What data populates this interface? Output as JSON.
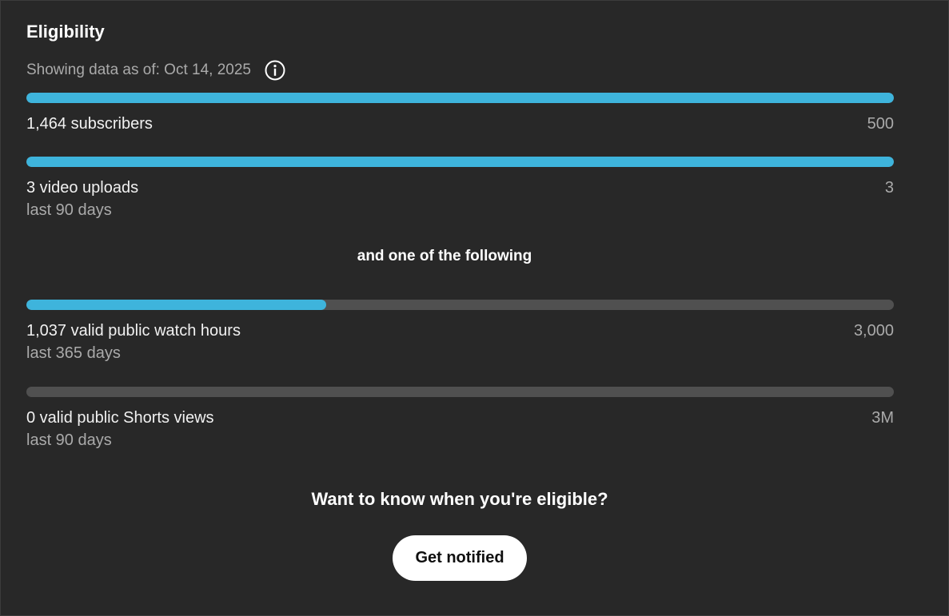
{
  "header": {
    "title": "Eligibility",
    "as_of": "Showing data as of: Oct 14, 2025",
    "info_icon": "info-icon"
  },
  "metrics": [
    {
      "label": "1,464 subscribers",
      "target": "500",
      "sublabel": "",
      "progress": 1.0
    },
    {
      "label": "3 video uploads",
      "target": "3",
      "sublabel": "last 90 days",
      "progress": 1.0
    },
    {
      "label": "1,037 valid public watch hours",
      "target": "3,000",
      "sublabel": "last 365 days",
      "progress": 0.3457
    },
    {
      "label": "0 valid public Shorts views",
      "target": "3M",
      "sublabel": "last 90 days",
      "progress": 0.0
    }
  ],
  "divider_text": "and one of the following",
  "cta": {
    "question": "Want to know when you're eligible?",
    "button_label": "Get notified"
  },
  "colors": {
    "background": "#282828",
    "progress_fill": "#3eb4dc",
    "progress_track": "#505050",
    "button_bg": "#ffffff"
  }
}
